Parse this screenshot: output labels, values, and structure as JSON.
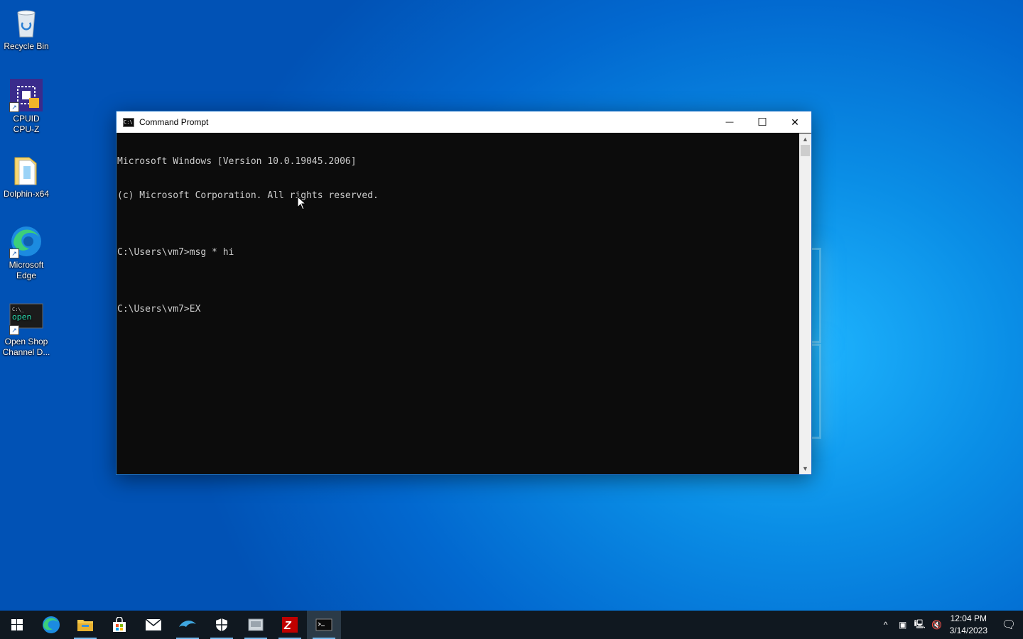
{
  "desktop": {
    "icons": [
      {
        "label_lines": [
          "Recycle Bin"
        ]
      },
      {
        "label_lines": [
          "CPUID",
          "CPU-Z"
        ]
      },
      {
        "label_lines": [
          "Dolphin-x64"
        ]
      },
      {
        "label_lines": [
          "Microsoft",
          "Edge"
        ]
      },
      {
        "label_lines": [
          "Open Shop",
          "Channel D..."
        ]
      }
    ]
  },
  "window": {
    "title": "Command Prompt",
    "minimize_glyph": "—",
    "maximize_glyph": "☐",
    "close_glyph": "✕",
    "console_lines": [
      "Microsoft Windows [Version 10.0.19045.2006]",
      "(c) Microsoft Corporation. All rights reserved.",
      "",
      "C:\\Users\\vm7>msg * hi",
      "",
      "C:\\Users\\vm7>EX"
    ]
  },
  "taskbar": {
    "apps": [
      "start-icon",
      "edge-icon",
      "file-explorer-icon",
      "store-icon",
      "mail-icon",
      "dolphin-icon",
      "security-icon",
      "app-icon",
      "filezilla-icon",
      "command-prompt-icon"
    ],
    "active_app": "command-prompt-icon",
    "clock": {
      "time": "12:04 PM",
      "date": "3/14/2023"
    }
  },
  "colors": {
    "accent": "#1c73c9",
    "console_bg": "#0c0c0c",
    "console_text": "#cccccc",
    "taskbar": "#101820"
  }
}
